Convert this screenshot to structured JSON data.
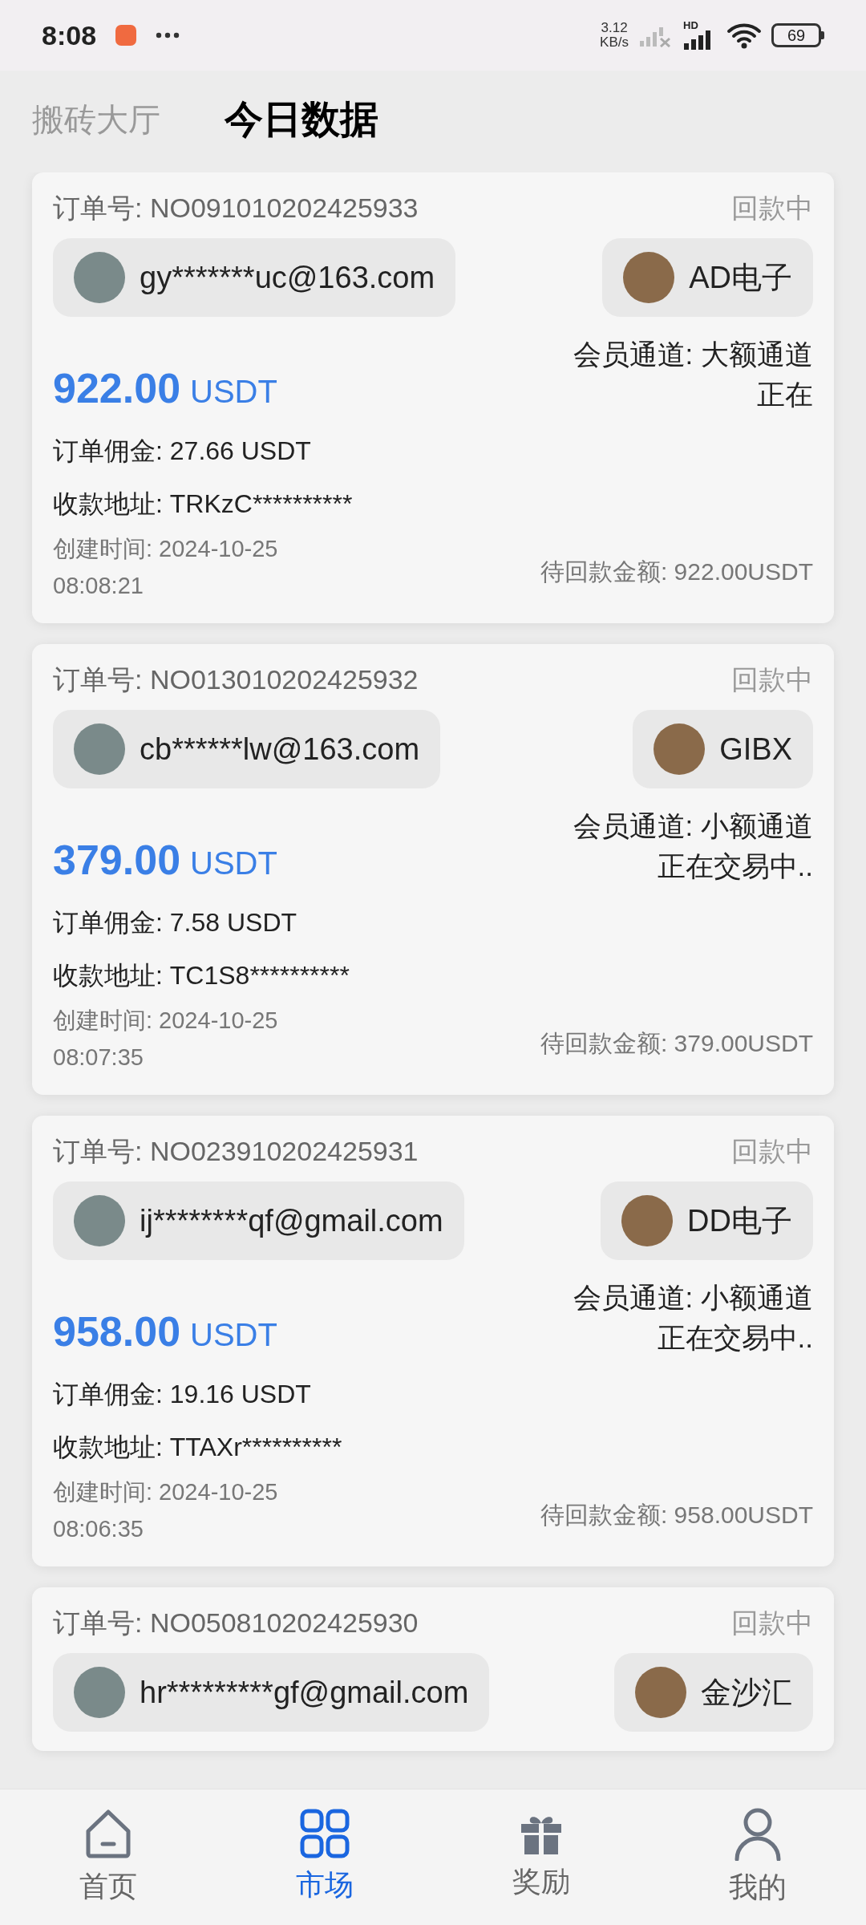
{
  "status_bar": {
    "time": "8:08",
    "net_speed": "3.12",
    "net_unit": "KB/s",
    "network_label": "HD",
    "battery": "69"
  },
  "tabs": [
    {
      "label": "搬砖大厅",
      "selected": false
    },
    {
      "label": "今日数据",
      "selected": true
    }
  ],
  "orders": [
    {
      "order_no": "订单号: NO091010202425933",
      "status": "回款中",
      "user": "gy*******uc@163.com",
      "platform": "AD电子",
      "amount": "922.00",
      "currency": "USDT",
      "channel": "会员通道: 大额通道",
      "channel_status": "正在",
      "commission": "订单佣金: 27.66 USDT",
      "address": "收款地址: TRKzC**********",
      "created_date": "创建时间: 2024-10-25",
      "created_time": "08:08:21",
      "pending": "待回款金额: 922.00USDT"
    },
    {
      "order_no": "订单号: NO013010202425932",
      "status": "回款中",
      "user": "cb******lw@163.com",
      "platform": "GIBX",
      "amount": "379.00",
      "currency": "USDT",
      "channel": "会员通道: 小额通道",
      "channel_status": "正在交易中..",
      "commission": "订单佣金: 7.58 USDT",
      "address": "收款地址: TC1S8**********",
      "created_date": "创建时间: 2024-10-25",
      "created_time": "08:07:35",
      "pending": "待回款金额: 379.00USDT"
    },
    {
      "order_no": "订单号: NO023910202425931",
      "status": "回款中",
      "user": "ij********qf@gmail.com",
      "platform": "DD电子",
      "amount": "958.00",
      "currency": "USDT",
      "channel": "会员通道: 小额通道",
      "channel_status": "正在交易中..",
      "commission": "订单佣金: 19.16 USDT",
      "address": "收款地址: TTAXr**********",
      "created_date": "创建时间: 2024-10-25",
      "created_time": "08:06:35",
      "pending": "待回款金额: 958.00USDT"
    },
    {
      "order_no": "订单号: NO050810202425930",
      "status": "回款中",
      "user": "hr*********gf@gmail.com",
      "platform": "金沙汇"
    }
  ],
  "nav": [
    {
      "label": "首页",
      "selected": false
    },
    {
      "label": "市场",
      "selected": true
    },
    {
      "label": "奖励",
      "selected": false
    },
    {
      "label": "我的",
      "selected": false
    }
  ]
}
